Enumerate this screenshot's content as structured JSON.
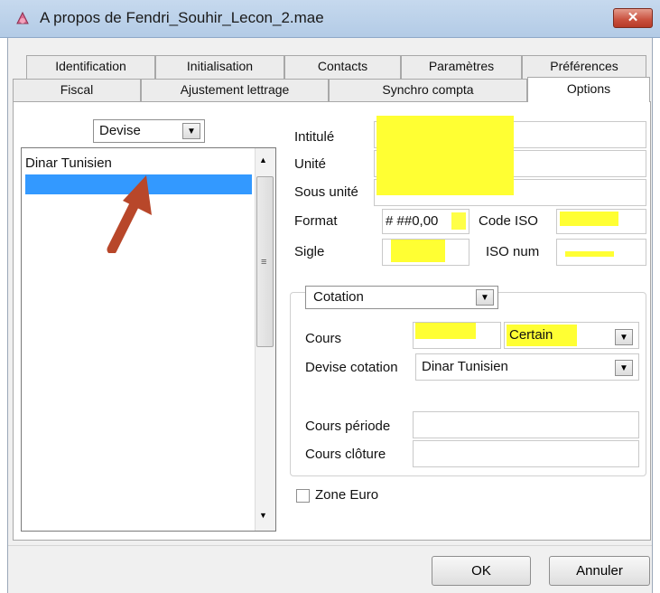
{
  "window": {
    "title": "A propos de Fendri_Souhir_Lecon_2.mae",
    "close_label": "✕"
  },
  "tabs": {
    "row1": [
      "Identification",
      "Initialisation",
      "Contacts",
      "Paramètres",
      "Préférences"
    ],
    "row2": [
      "Fiscal",
      "Ajustement lettrage",
      "Synchro compta",
      "Options"
    ],
    "active": "Options"
  },
  "left_panel": {
    "filter_select": "Devise",
    "items": [
      "Dinar Tunisien",
      ""
    ],
    "selected_index": 1
  },
  "form": {
    "intitule": {
      "label": "Intitulé",
      "value": ""
    },
    "unite": {
      "label": "Unité",
      "value": ""
    },
    "sous_unite": {
      "label": "Sous unité",
      "value": ""
    },
    "format": {
      "label": "Format",
      "value": "# ##0,00"
    },
    "code_iso": {
      "label": "Code ISO",
      "value": ""
    },
    "sigle": {
      "label": "Sigle",
      "value": ""
    },
    "iso_num": {
      "label": "ISO num",
      "value": ""
    }
  },
  "cotation": {
    "select": "Cotation",
    "cours": {
      "label": "Cours",
      "value": "",
      "mode": "Certain"
    },
    "devise_cotation": {
      "label": "Devise cotation",
      "value": "Dinar Tunisien"
    },
    "cours_periode": {
      "label": "Cours période",
      "value": ""
    },
    "cours_cloture": {
      "label": "Cours clôture",
      "value": ""
    }
  },
  "zone_euro": {
    "label": "Zone Euro",
    "checked": false
  },
  "buttons": {
    "ok": "OK",
    "cancel": "Annuler"
  },
  "colors": {
    "highlight": "#ffff33",
    "selection": "#3399ff",
    "annotation_arrow": "#b8472a"
  }
}
